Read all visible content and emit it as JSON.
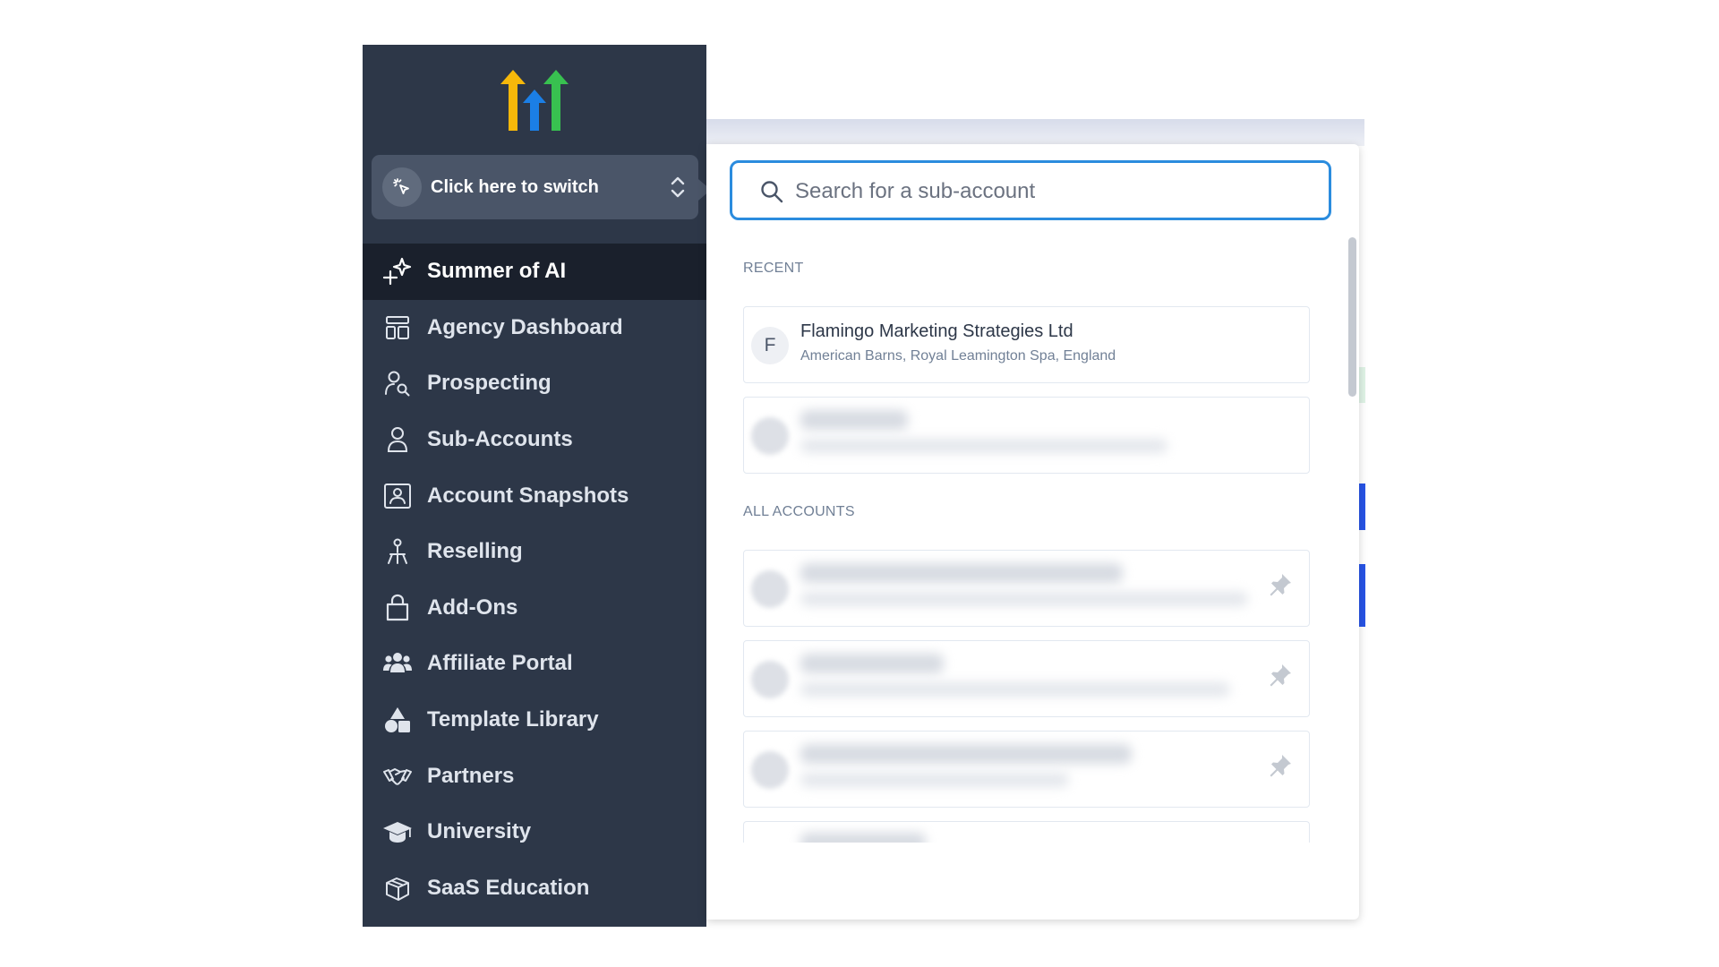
{
  "sidebar": {
    "switcher_label": "Click here to switch",
    "items": [
      {
        "label": "Summer of AI",
        "icon": "sparkles-icon",
        "active": true
      },
      {
        "label": "Agency Dashboard",
        "icon": "dashboard-icon"
      },
      {
        "label": "Prospecting",
        "icon": "user-search-icon"
      },
      {
        "label": "Sub-Accounts",
        "icon": "user-icon"
      },
      {
        "label": "Account Snapshots",
        "icon": "snapshot-icon"
      },
      {
        "label": "Reselling",
        "icon": "reselling-icon"
      },
      {
        "label": "Add-Ons",
        "icon": "bag-icon"
      },
      {
        "label": "Affiliate Portal",
        "icon": "users-icon"
      },
      {
        "label": "Template Library",
        "icon": "shapes-icon"
      },
      {
        "label": "Partners",
        "icon": "handshake-icon"
      },
      {
        "label": "University",
        "icon": "graduation-cap-icon"
      },
      {
        "label": "SaaS Education",
        "icon": "box-icon"
      }
    ]
  },
  "panel": {
    "search_placeholder": "Search for a sub-account",
    "recent_label": "RECENT",
    "all_accounts_label": "ALL ACCOUNTS",
    "recent": [
      {
        "initial": "F",
        "name": "Flamingo Marketing Strategies Ltd",
        "address": "American Barns, Royal Leamington Spa, England"
      }
    ]
  },
  "colors": {
    "sidebar_bg": "#2d3748",
    "active_bg": "#1a202c",
    "search_border": "#2b8cde",
    "logo_yellow": "#f6b80a",
    "logo_blue": "#1b7fe6",
    "logo_green": "#38c150"
  }
}
